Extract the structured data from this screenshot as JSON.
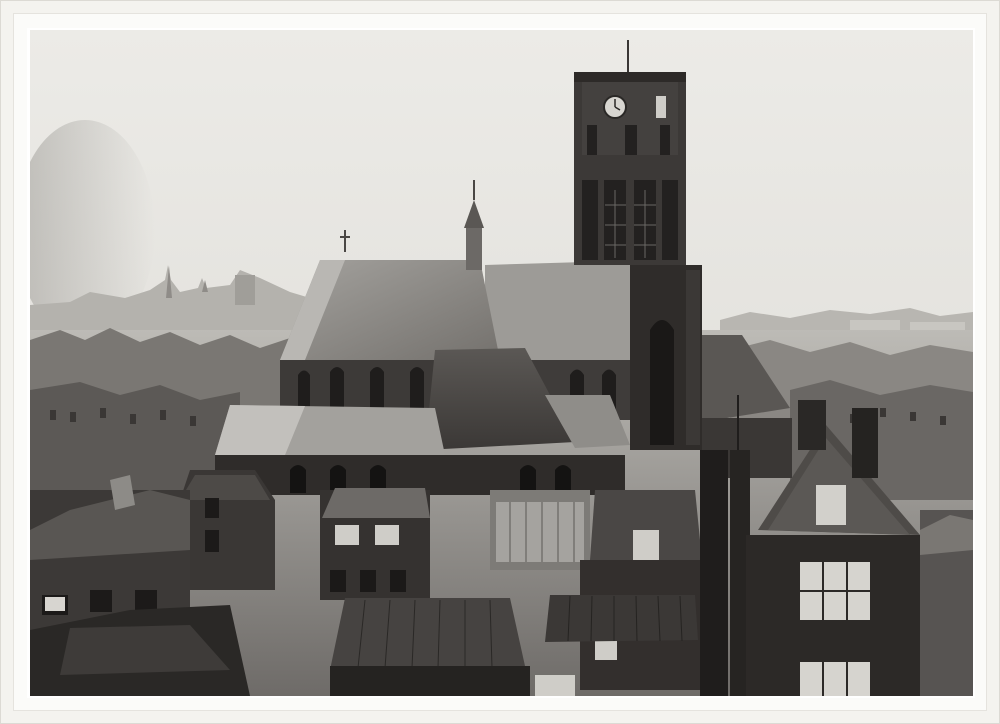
{
  "image": {
    "subject": "",
    "palette": {
      "sky": "#e8e6e1",
      "haze": "#c9c7c2",
      "roof_light": "#8f8d89",
      "roof_mid": "#5d5a57",
      "roof_dark": "#3a3735",
      "brick": "#2d2a28",
      "shadow": "#1c1a19",
      "frame": "#f4f3ef"
    }
  }
}
